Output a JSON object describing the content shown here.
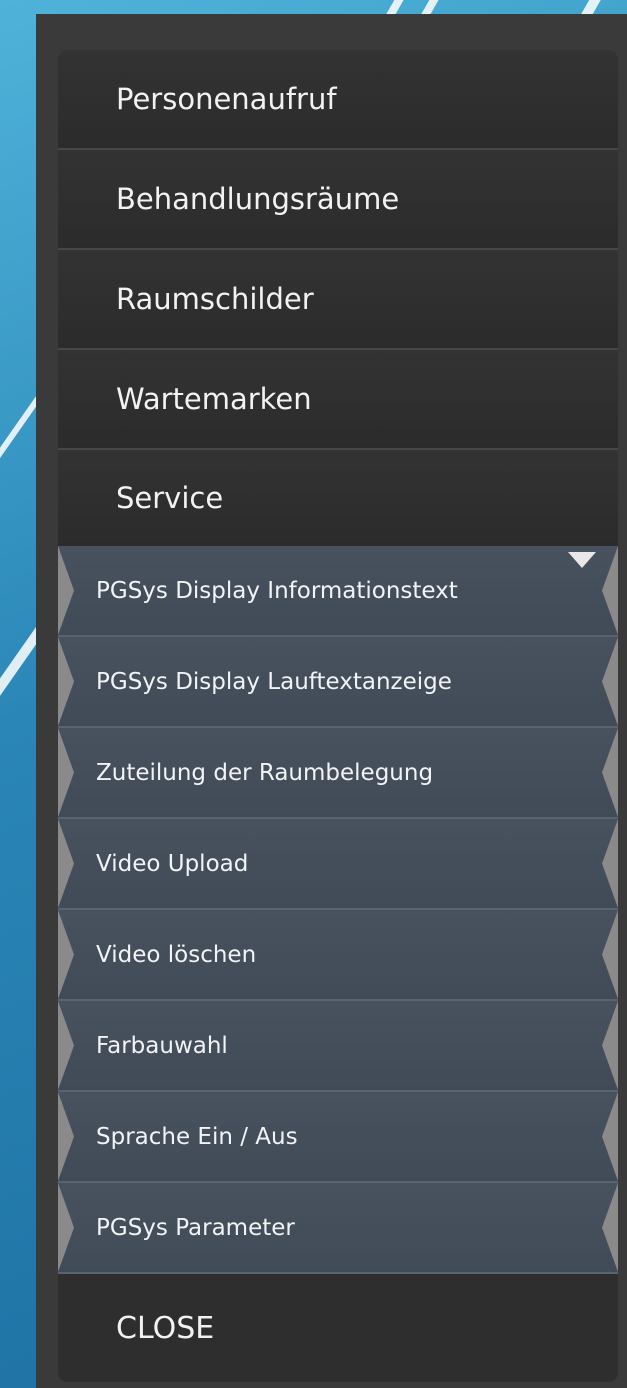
{
  "colors": {
    "panel": "#3a3a3a",
    "menu_item": "#2d2d2d",
    "submenu": "#46505c",
    "text": "#f2f2f2",
    "background_blue": "#2a86b7"
  },
  "menu": {
    "items": [
      {
        "label": "Personenaufruf"
      },
      {
        "label": "Behandlungsräume"
      },
      {
        "label": "Raumschilder"
      },
      {
        "label": "Wartemarken"
      },
      {
        "label": "Service"
      }
    ],
    "service_submenu": [
      {
        "label": "PGSys Display Informationstext"
      },
      {
        "label": "PGSys Display Lauftextanzeige"
      },
      {
        "label": "Zuteilung der Raumbelegung"
      },
      {
        "label": "Video Upload"
      },
      {
        "label": "Video löschen"
      },
      {
        "label": "Farbauwahl"
      },
      {
        "label": "Sprache Ein / Aus"
      },
      {
        "label": "PGSys Parameter"
      }
    ],
    "close_label": "CLOSE"
  }
}
